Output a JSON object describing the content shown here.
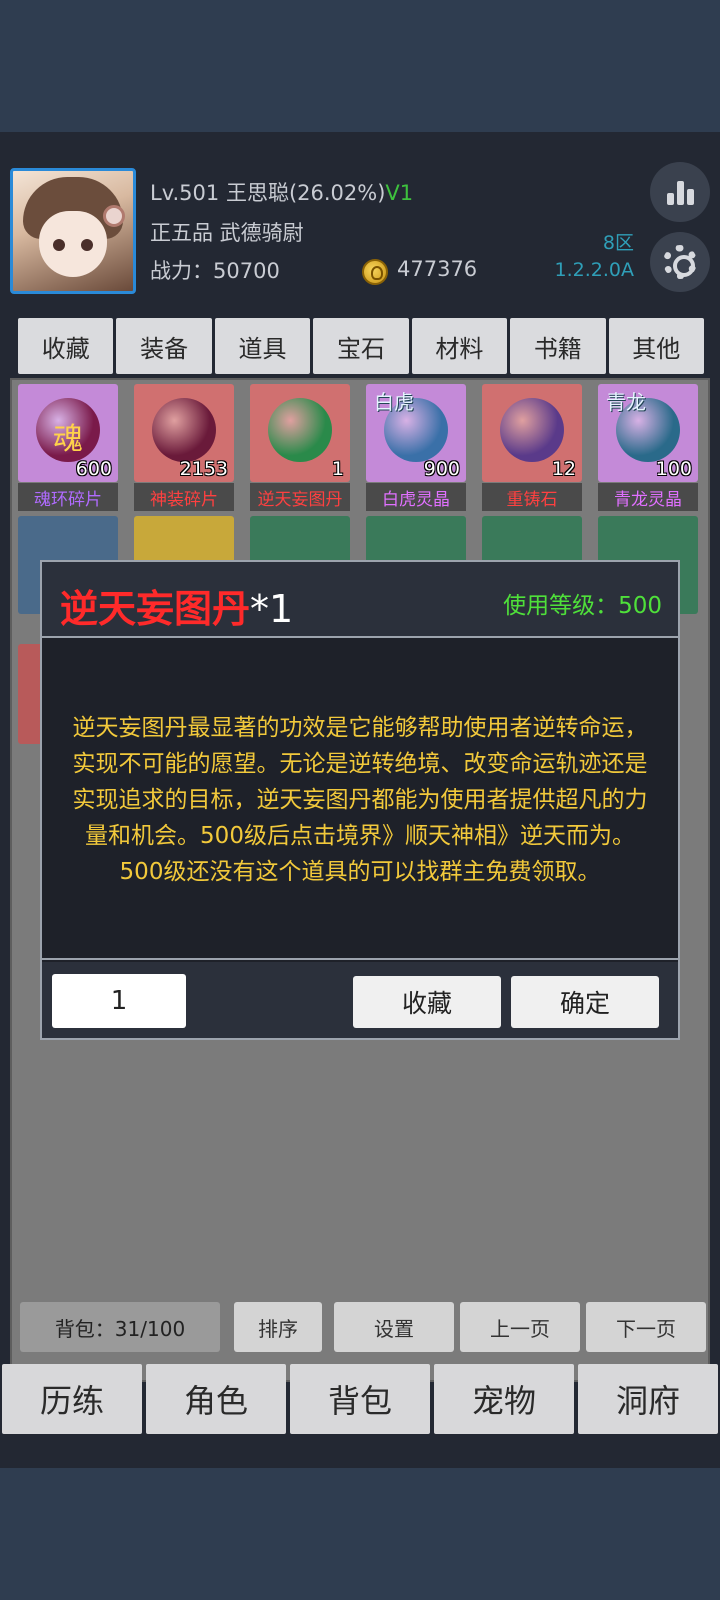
{
  "player": {
    "level": "Lv.501",
    "name": "王思聪(26.02%)",
    "vip": "V1",
    "rank": "正五品  武德骑尉",
    "power": "战力：50700",
    "coins": "477376",
    "zone": "8区",
    "version": "1.2.2.0A"
  },
  "tabs": [
    "收藏",
    "装备",
    "道具",
    "宝石",
    "材料",
    "书籍",
    "其他"
  ],
  "items_row1": [
    {
      "name": "魂环碎片",
      "count": "600",
      "name_color": "#b06bff",
      "bg": "#c48ad8",
      "orb": "#7a1a4a",
      "glyph": "魂",
      "tag": ""
    },
    {
      "name": "神装碎片",
      "count": "2153",
      "name_color": "#ff4040",
      "bg": "#d07070",
      "orb": "#6a1a3a",
      "glyph": "",
      "tag": ""
    },
    {
      "name": "逆天妄图丹",
      "count": "1",
      "name_color": "#ff4040",
      "bg": "#d07070",
      "orb": "#2a8a4a",
      "glyph": "",
      "tag": ""
    },
    {
      "name": "白虎灵晶",
      "count": "900",
      "name_color": "#e070ff",
      "bg": "#c48ad8",
      "orb": "#3a70a8",
      "glyph": "",
      "tag": "白虎"
    },
    {
      "name": "重铸石",
      "count": "12",
      "name_color": "#ff4040",
      "bg": "#d07070",
      "orb": "#5a3a8a",
      "glyph": "",
      "tag": ""
    },
    {
      "name": "青龙灵晶",
      "count": "100",
      "name_color": "#e070ff",
      "bg": "#c48ad8",
      "orb": "#2a6a8a",
      "glyph": "",
      "tag": "青龙"
    }
  ],
  "modal": {
    "title": "逆天妄图丹",
    "qty": "*1",
    "use_level": "使用等级：500",
    "description": "逆天妄图丹最显著的功效是它能够帮助使用者逆转命运，实现不可能的愿望。无论是逆转绝境、改变命运轨迹还是实现追求的目标，逆天妄图丹都能为使用者提供超凡的力量和机会。500级后点击境界》顺天神相》逆天而为。500级还没有这个道具的可以找群主免费领取。",
    "input_value": "1",
    "collect_label": "收藏",
    "confirm_label": "确定"
  },
  "inventory_bar": {
    "bag_count": "背包：31/100",
    "sort": "排序",
    "settings": "设置",
    "prev": "上一页",
    "next": "下一页"
  },
  "bottom_nav": [
    "历练",
    "角色",
    "背包",
    "宠物",
    "洞府"
  ],
  "colors": {
    "title_red": "#ff2a2a",
    "desc_yellow": "#f2c93b",
    "level_green": "#4fe03a",
    "version_teal": "#2f9fb8"
  }
}
